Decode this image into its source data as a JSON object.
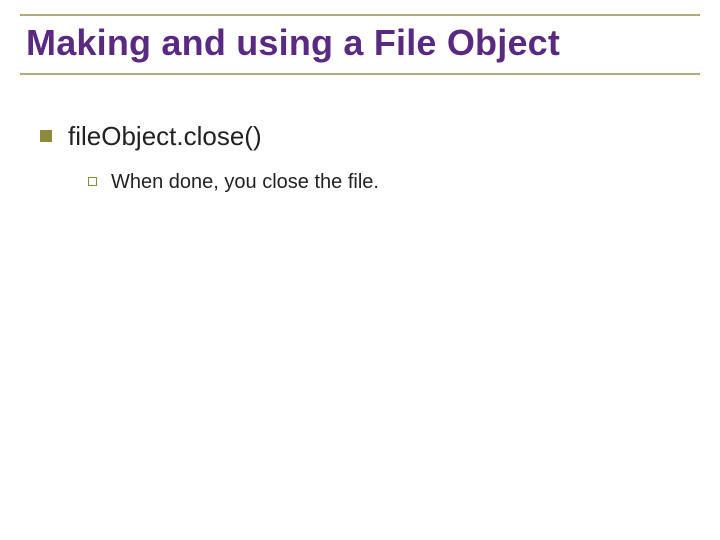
{
  "title": "Making and using a File Object",
  "items": [
    {
      "label": "fileObject.close()",
      "children": [
        {
          "label": "When done, you close the file."
        }
      ]
    }
  ]
}
